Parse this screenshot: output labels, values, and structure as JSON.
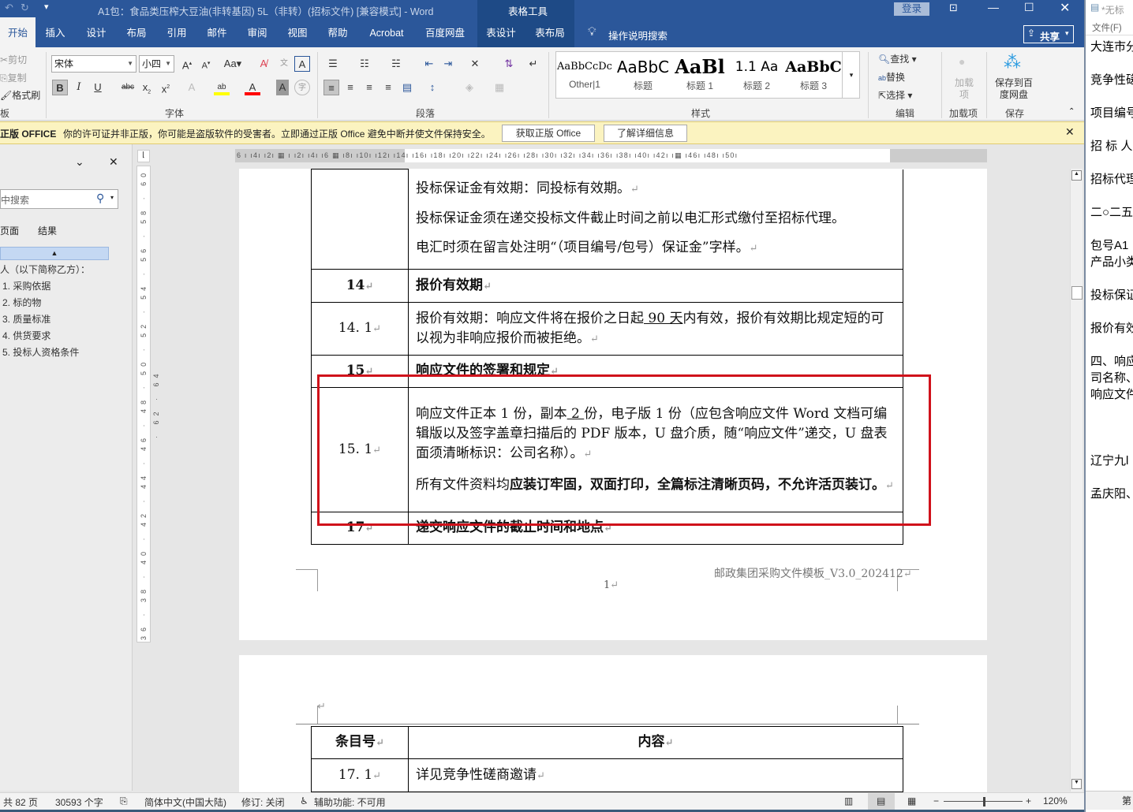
{
  "titlebar": {
    "title": "A1包：食品类压榨大豆油(非转基因) 5L（非转）(招标文件) [兼容模式]  -  Word",
    "context_tab_group": "表格工具",
    "login": "登录"
  },
  "tabs": [
    {
      "label": "开始",
      "active": true
    },
    {
      "label": "插入"
    },
    {
      "label": "设计"
    },
    {
      "label": "布局"
    },
    {
      "label": "引用"
    },
    {
      "label": "邮件"
    },
    {
      "label": "审阅"
    },
    {
      "label": "视图"
    },
    {
      "label": "帮助"
    },
    {
      "label": "Acrobat"
    },
    {
      "label": "百度网盘"
    },
    {
      "label": "表设计"
    },
    {
      "label": "表布局"
    }
  ],
  "tell_me": "操作说明搜索",
  "share": "共享",
  "ribbon": {
    "clipboard": {
      "cut": "剪切",
      "copy": "复制",
      "format_painter": "格式刷",
      "label": "板"
    },
    "font": {
      "name": "宋体",
      "size": "小四",
      "label": "字体",
      "highlight_color": "#ffff00",
      "font_color": "#ff0000"
    },
    "paragraph": {
      "label": "段落"
    },
    "styles": {
      "label": "样式",
      "items": [
        {
          "preview": "AaBbCcDc",
          "name": "Other|1"
        },
        {
          "preview": "AaBbC",
          "name": "标题"
        },
        {
          "preview": "AaBl",
          "name": "标题 1"
        },
        {
          "preview": "1.1  Aa",
          "name": "标题 2"
        },
        {
          "preview": "AaBbC",
          "name": "标题 3"
        }
      ]
    },
    "editing": {
      "find": "查找",
      "replace": "替换",
      "select": "选择",
      "label": "编辑"
    },
    "addins": {
      "button": "加载项",
      "label": "加载项"
    },
    "save": {
      "button": "保存到百度网盘",
      "label": "保存"
    }
  },
  "warning": {
    "brand": "正版 OFFICE",
    "message": "你的许可证并非正版，你可能是盗版软件的受害者。立即通过正版 Office 避免中断并使文件保持安全。",
    "get_genuine": "获取正版 Office",
    "learn_more": "了解详细信息"
  },
  "nav": {
    "search_placeholder": "中搜索",
    "tabs": [
      "页面",
      "结果"
    ],
    "items": [
      "人（以下简称乙方）：",
      "1. 采购依据",
      "2. 标的物",
      "3. 质量标准",
      "4. 供货要求",
      "5. 投标人资格条件"
    ]
  },
  "ruler": {
    "ticks": "6 ı  ı4ı  ı2ı  ▦ ı  ı2ı  ı4ı  ı6 ▦ ı8ı  ı10ı  ı12ı  ı14ı  ı16ı  ı18ı  ı20ı  ı22ı  ı24ı  ı26ı  ı28ı  ı30ı  ı32ı  ı34ı  ı36ı  ı38ı  ı40ı  ı42ı  ı▦  ı46ı  ı48ı  ı50ı",
    "vticks": "36 · 38 · 40 · 42 · 44 · 46 · 48 · 50 · 52 · 54 · 56 · 58 · 60 · 62 · 64"
  },
  "doc": {
    "row13": [
      "投标保证金有效期：同投标有效期。",
      "投标保证金须在递交投标文件截止时间之前以电汇形式缴付至招标代理。",
      "电汇时须在留言处注明“（项目编号/包号）保证金”字样。"
    ],
    "row14": {
      "num": "14",
      "text": "报价有效期"
    },
    "row141": {
      "num": "14. 1",
      "pre": "报价有效期：响应文件将在报价之日起",
      "days": " 90 天",
      "post": "内有效，报价有效期比规定短的可以视为非响应报价而被拒绝。"
    },
    "row15": {
      "num": "15",
      "text": "响应文件的签署和规定"
    },
    "row151": {
      "num": "15. 1",
      "p1a": "响应文件正本 1 份，副本",
      "copies": " 2 ",
      "p1b": "份，电子版 1 份（应包含响应文件 Word 文档可编辑版以及签字盖章扫描后的 PDF 版本，U 盘介质，随“响应文件”递交，U 盘表面须清晰标识：公司名称）。",
      "p2a": "所有文件资料均",
      "p2b": "应装订牢固，双面打印，全篇标注清晰页码，不允许活页装订。"
    },
    "row17": {
      "num": "17",
      "text": "递交响应文件的截止时间和地点"
    },
    "footer": "邮政集团采购文件模板_V3.0_202412",
    "page_number": "1",
    "page2_header": [
      "条目号",
      "内容"
    ],
    "page2_row": {
      "num": "17. 1",
      "text": "详见竞争性磋商邀请"
    },
    "highlight_color": "#d0121b"
  },
  "status": {
    "pages": "共 82 页",
    "words": "30593 个字",
    "language": "简体中文(中国大陆)",
    "track": "修订: 关闭",
    "accessibility": "辅助功能: 不可用",
    "zoom": "120%"
  },
  "notepad": {
    "title": "*无标",
    "menu": "文件(F)",
    "lines": [
      "大连市分",
      "竞争性磋",
      "项目编号",
      "招  标  人",
      "招标代理",
      "二○二五",
      "包号A1",
      "产品小类",
      "投标保证",
      "报价有效",
      "四、响应",
      "司名称、",
      "响应文件",
      "辽宁九l",
      "孟庆阳、"
    ],
    "status": "第"
  }
}
